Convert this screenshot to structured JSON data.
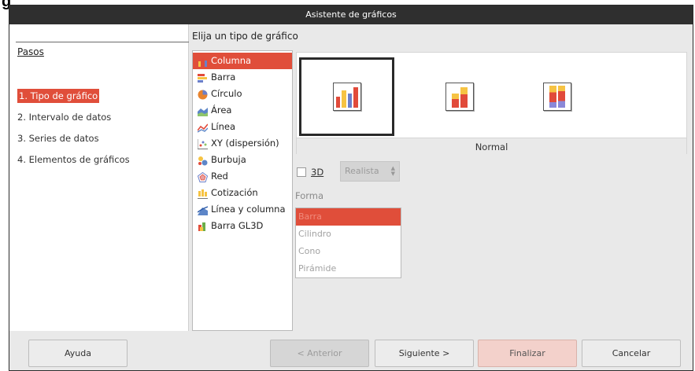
{
  "window": {
    "title": "Asistente de gráficos",
    "cut_label": "g"
  },
  "steps": {
    "title": "Pasos",
    "items": [
      {
        "label": "1. Tipo de gráfico",
        "active": true
      },
      {
        "label": "2. Intervalo de datos"
      },
      {
        "label": "3. Series de datos"
      },
      {
        "label": "4. Elementos de gráficos"
      }
    ]
  },
  "main": {
    "heading": "Elija un tipo de gráfico",
    "chart_types": [
      {
        "label": "Columna",
        "icon": "column-chart-icon",
        "selected": true
      },
      {
        "label": "Barra",
        "icon": "bar-chart-icon"
      },
      {
        "label": "Círculo",
        "icon": "pie-chart-icon"
      },
      {
        "label": "Área",
        "icon": "area-chart-icon"
      },
      {
        "label": "Línea",
        "icon": "line-chart-icon"
      },
      {
        "label": "XY (dispersión)",
        "icon": "scatter-chart-icon"
      },
      {
        "label": "Burbuja",
        "icon": "bubble-chart-icon"
      },
      {
        "label": "Red",
        "icon": "net-chart-icon"
      },
      {
        "label": "Cotización",
        "icon": "stock-chart-icon"
      },
      {
        "label": "Línea y columna",
        "icon": "column-line-chart-icon"
      },
      {
        "label": "Barra GL3D",
        "icon": "gl3d-bar-chart-icon"
      }
    ],
    "variants": [
      {
        "name": "normal-variant",
        "selected": true
      },
      {
        "name": "stacked-variant"
      },
      {
        "name": "percent-stacked-variant"
      }
    ],
    "variant_caption": "Normal",
    "three_d": {
      "label": "3D",
      "checked": false
    },
    "style_select": {
      "value": "Realista"
    },
    "shape": {
      "label": "Forma",
      "options": [
        {
          "label": "Barra",
          "selected": true
        },
        {
          "label": "Cilindro"
        },
        {
          "label": "Cono"
        },
        {
          "label": "Pirámide"
        }
      ]
    }
  },
  "buttons": {
    "help": "Ayuda",
    "back": "< Anterior",
    "next": "Siguiente >",
    "finish": "Finalizar",
    "cancel": "Cancelar"
  },
  "colors": {
    "accent": "#e04e3a",
    "titlebar": "#2f2f2f",
    "window_bg": "#e9e9e9"
  }
}
